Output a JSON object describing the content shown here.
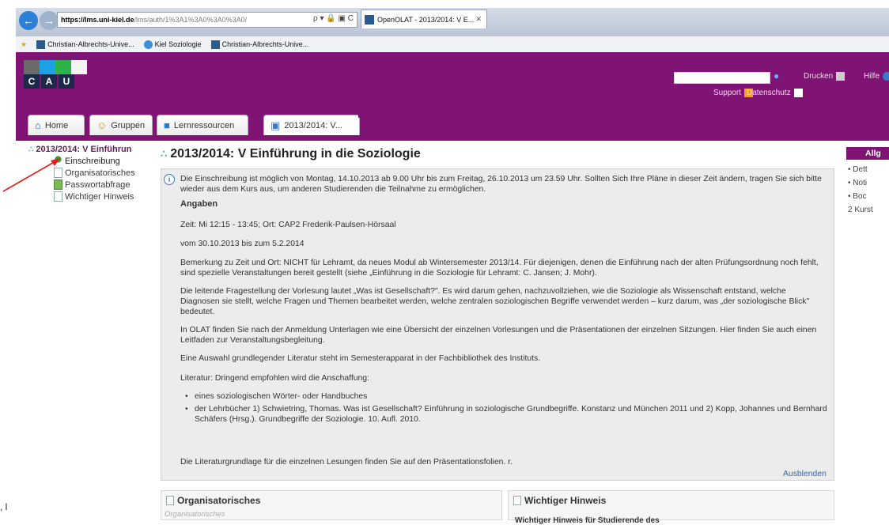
{
  "browser": {
    "url_host": "https://lms.uni-kiel.de",
    "url_path": "/lms/auth/1%3A1%3A0%3A0%3A0/",
    "url_tools": "ρ ▾ 🔒 ▣ C",
    "tab_title": "OpenOLAT - 2013/2014: V E...",
    "tab_close": "✕",
    "bookmarks": [
      "Christian-Albrechts-Unive...",
      "Kiel Soziologie",
      "Christian-Albrechts-Unive..."
    ]
  },
  "header": {
    "logo_letters": [
      "C",
      "A",
      "U"
    ],
    "logo_colors": [
      "#6a6a6a",
      "#1da1e6",
      "#2cb34a",
      "#f4f4f4"
    ],
    "print_label": "Drucken",
    "help_label": "Hilfe",
    "support_label": "Support",
    "privacy_label": "Datenschutz"
  },
  "tabs": [
    {
      "label": "Home",
      "icon": "home-icon"
    },
    {
      "label": "Gruppen",
      "icon": "group-icon"
    },
    {
      "label": "Lernressourcen",
      "icon": "book-icon"
    },
    {
      "label": "2013/2014: V...",
      "icon": "course-icon"
    }
  ],
  "tree": {
    "root": "2013/2014: V Einführun",
    "nodes": [
      {
        "label": "Einschreibung"
      },
      {
        "label": "Organisatorisches"
      },
      {
        "label": "Passwortabfrage"
      },
      {
        "label": "Wichtiger Hinweis"
      }
    ]
  },
  "main": {
    "title": "2013/2014: V Einführung in die Soziologie",
    "intro": "Die Einschreibung ist möglich von Montag, 14.10.2013 ab 9.00 Uhr bis zum Freitag, 26.10.2013 um 23.59 Uhr. Sollten Sich Ihre Pläne in dieser Zeit ändern, tragen Sie sich bitte wieder aus dem Kurs aus, um anderen Studierenden die Teilnahme zu ermöglichen.",
    "angaben_heading": "Angaben",
    "zeit": "Zeit: Mi 12:15 - 13:45; Ort: CAP2 Frederik-Paulsen-Hörsaal",
    "vom": "vom 30.10.2013 bis zum 5.2.2014",
    "bemerkung": "Bemerkung zu Zeit und Ort: NICHT für Lehramt, da neues Modul ab Wintersemester 2013/14. Für diejenigen, denen die Einführung nach der alten Prüfungsordnung noch fehlt, sind spezielle Veranstaltungen bereit gestellt (siehe „Einführung in die Soziologie für Lehramt: C. Jansen; J. Mohr).",
    "leitende": "Die leitende Fragestellung der Vorlesung lautet „Was ist Gesellschaft?\". Es wird darum gehen, nachzuvollziehen, wie die Soziologie als Wissenschaft entstand, welche Diagnosen sie stellt, welche Fragen und Themen bearbeitet werden, welche zentralen soziologischen Begriffe verwendet werden – kurz darum, was „der soziologische Blick\" bedeutet.",
    "olat": "In OLAT finden Sie nach der Anmeldung Unterlagen wie eine Übersicht der einzelnen Vorlesungen und die Präsentationen der einzelnen Sitzungen. Hier finden Sie auch einen Leitfaden zur Veranstaltungsbegleitung.",
    "auswahl": "Eine Auswahl grundlegender Literatur steht im Semesterapparat in der Fachbibliothek des Instituts.",
    "literatur": "Literatur: Dringend empfohlen wird die Anschaffung:",
    "bullets": [
      "eines soziologischen Wörter- oder Handbuches",
      "der Lehrbücher 1) Schwietring, Thomas. Was ist Gesellschaft? Einführung in soziologische Grundbegriffe. Konstanz und München 2011 und 2) Kopp, Johannes und Bernhard Schäfers (Hrsg.). Grundbegriffe der Soziologie. 10. Aufl. 2010."
    ],
    "grundlage": "Die Literaturgrundlage für die einzelnen Lesungen finden Sie auf den Präsentationsfolien. r.",
    "hide_link": "Ausblenden"
  },
  "panels": [
    {
      "title": "Organisatorisches",
      "sub": "Organisatorisches"
    },
    {
      "title": "Wichtiger Hinweis",
      "sub": "Wichtiger Hinweis für Studierende des"
    }
  ],
  "right": {
    "heading": "Allg",
    "items": [
      "• Dett",
      "• Noti",
      "• Boc"
    ],
    "count": "2 Kurst"
  },
  "margin_mark": ", l",
  "colors": {
    "brand": "#7f1474",
    "link": "#3a64a6",
    "arrow": "#e02020"
  }
}
